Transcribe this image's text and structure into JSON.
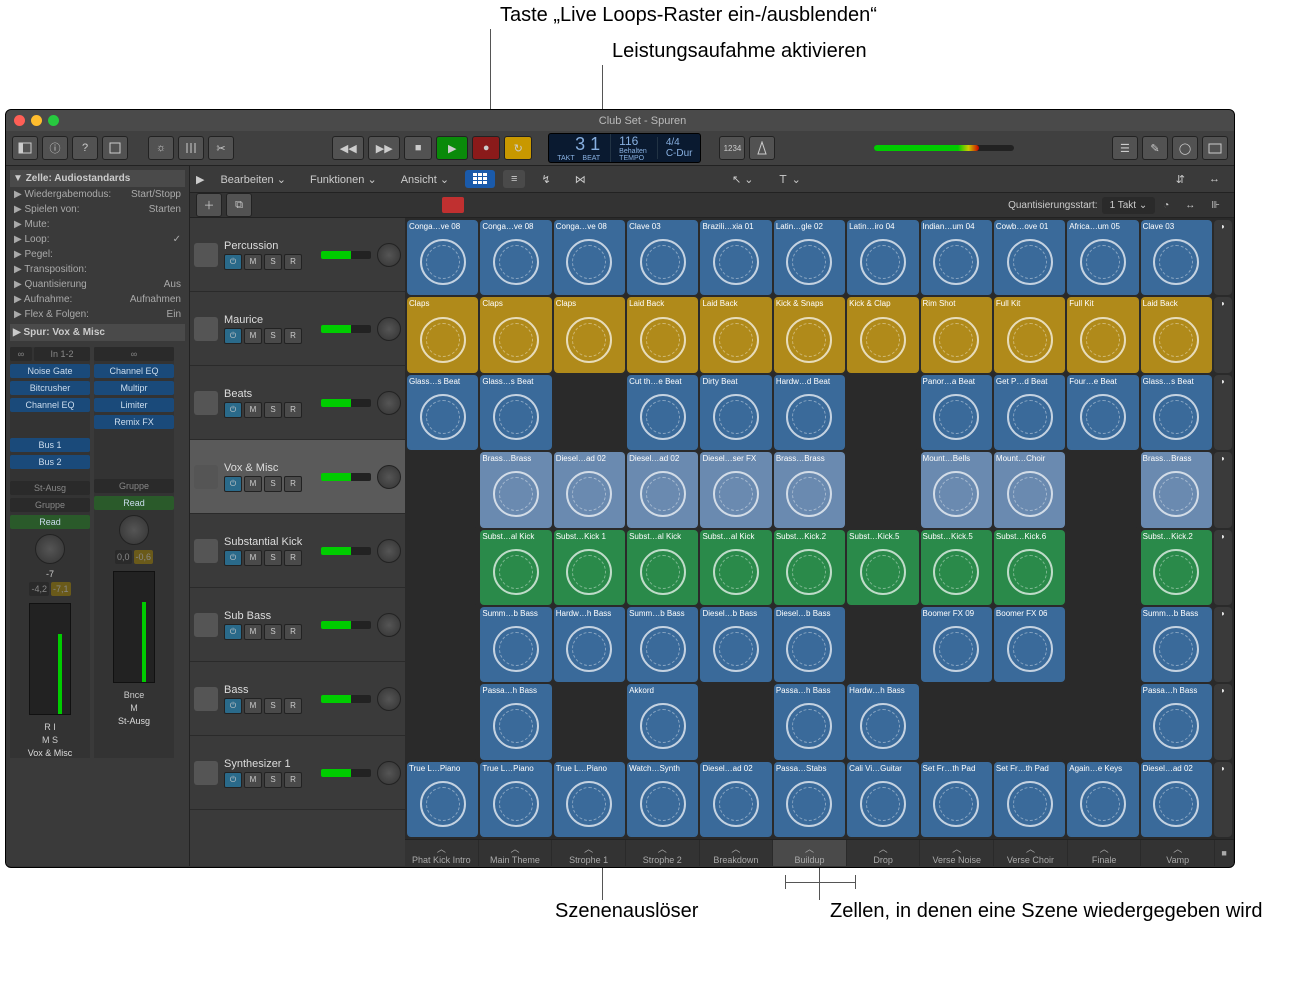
{
  "callouts": {
    "top1": "Taste „Live Loops-Raster ein-/ausblenden“",
    "top2": "Leistungsaufahme aktivieren",
    "bot1": "Szenenauslöser",
    "bot2": "Zellen, in denen eine Szene wiedergegeben wird"
  },
  "title": "Club Set - Spuren",
  "lcd": {
    "bars": "3",
    "beats": "1",
    "lbars": "TAKT",
    "lbeats": "BEAT",
    "tempo": "116",
    "tempo_l": "Behalten",
    "tempo_l2": "TEMPO",
    "sig": "4/4",
    "key": "C-Dur"
  },
  "secbar": {
    "edit": "Bearbeiten",
    "func": "Funktionen",
    "view": "Ansicht"
  },
  "qbar": {
    "qstart": "Quantisierungsstart:",
    "qval": "1 Takt"
  },
  "inspector": {
    "hdr": "Zelle: Audiostandards",
    "rows": [
      [
        "Wiedergabemodus:",
        "Start/Stopp"
      ],
      [
        "Spielen von:",
        "Starten"
      ],
      [
        "Mute:",
        ""
      ],
      [
        "Loop:",
        "✓"
      ],
      [
        "Pegel:",
        ""
      ],
      [
        "Transposition:",
        ""
      ],
      [
        "Quantisierung",
        "Aus"
      ],
      [
        "Aufnahme:",
        "Aufnahmen"
      ],
      [
        "Flex & Folgen:",
        "Ein"
      ]
    ],
    "spur": "Spur:  Vox & Misc"
  },
  "ch1": {
    "in": "In 1-2",
    "slots": [
      "Noise Gate",
      "Bitcrusher",
      "Channel EQ"
    ],
    "sends": [
      "Bus 1",
      "Bus 2"
    ],
    "out": "St-Ausg",
    "grp": "Gruppe",
    "auto": "Read",
    "db": "-7",
    "v1": "-4,2",
    "v2": "-7,1",
    "ri": "R  I",
    "ms": "M   S",
    "name": "Vox & Misc"
  },
  "ch2": {
    "slots": [
      "Channel EQ",
      "Multipr",
      "Limiter",
      "Remix FX"
    ],
    "out": "",
    "grp": "Gruppe",
    "auto": "Read",
    "db": "0,0",
    "v2": "-0,6",
    "bnce": "Bnce",
    "m": "M",
    "name": "St-Ausg"
  },
  "tracks": [
    "Percussion",
    "Maurice",
    "Beats",
    "Vox & Misc",
    "Substantial Kick",
    "Sub Bass",
    "Bass",
    "Synthesizer 1"
  ],
  "scenes": [
    "Phat Kick Intro",
    "Main Theme",
    "Strophe 1",
    "Strophe 2",
    "Breakdown",
    "Buildup",
    "Drop",
    "Verse Noise",
    "Verse Choir",
    "Finale",
    "Vamp"
  ],
  "cells": [
    [
      [
        "Conga…ve 08",
        "blue"
      ],
      [
        "Conga…ve 08",
        "blue"
      ],
      [
        "Conga…ve 08",
        "blue"
      ],
      [
        "Clave 03",
        "blue"
      ],
      [
        "Brazili…xia 01",
        "blue"
      ],
      [
        "Latin…gle 02",
        "blue"
      ],
      [
        "Latin…iro 04",
        "blue"
      ],
      [
        "Indian…um 04",
        "blue"
      ],
      [
        "Cowb…ove 01",
        "blue"
      ],
      [
        "Africa…um 05",
        "blue"
      ],
      [
        "Clave 03",
        "blue"
      ]
    ],
    [
      [
        "Claps",
        "yel"
      ],
      [
        "Claps",
        "yel"
      ],
      [
        "Claps",
        "yel"
      ],
      [
        "Laid Back",
        "yel"
      ],
      [
        "Laid Back",
        "yel"
      ],
      [
        "Kick & Snaps",
        "yel"
      ],
      [
        "Kick & Clap",
        "yel"
      ],
      [
        "Rim Shot",
        "yel"
      ],
      [
        "Full Kit",
        "yel"
      ],
      [
        "Full Kit",
        "yel"
      ],
      [
        "Laid Back",
        "yel"
      ]
    ],
    [
      [
        "Glass…s Beat",
        "blue"
      ],
      [
        "Glass…s Beat",
        "blue"
      ],
      [
        "",
        "empty"
      ],
      [
        "Cut th…e Beat",
        "blue"
      ],
      [
        "Dirty Beat",
        "blue"
      ],
      [
        "Hardw…d Beat",
        "blue"
      ],
      [
        "",
        "empty"
      ],
      [
        "Panor…a Beat",
        "blue"
      ],
      [
        "Get P…d Beat",
        "blue"
      ],
      [
        "Four…e Beat",
        "blue"
      ],
      [
        "Glass…s Beat",
        "blue"
      ]
    ],
    [
      [
        "",
        "empty"
      ],
      [
        "Brass…Brass",
        "ltblue"
      ],
      [
        "Diesel…ad 02",
        "ltblue"
      ],
      [
        "Diesel…ad 02",
        "ltblue"
      ],
      [
        "Diesel…ser FX",
        "ltblue"
      ],
      [
        "Brass…Brass",
        "ltblue"
      ],
      [
        "",
        "empty"
      ],
      [
        "Mount…Bells",
        "ltblue"
      ],
      [
        "Mount…Choir",
        "ltblue"
      ],
      [
        "",
        "empty"
      ],
      [
        "Brass…Brass",
        "ltblue"
      ]
    ],
    [
      [
        "",
        "empty"
      ],
      [
        "Subst…al Kick",
        "grn"
      ],
      [
        "Subst…Kick 1",
        "grn"
      ],
      [
        "Subst…al Kick",
        "grn"
      ],
      [
        "Subst…al Kick",
        "grn"
      ],
      [
        "Subst…Kick.2",
        "grn"
      ],
      [
        "Subst…Kick.5",
        "grn"
      ],
      [
        "Subst…Kick.5",
        "grn"
      ],
      [
        "Subst…Kick.6",
        "grn"
      ],
      [
        "",
        "empty"
      ],
      [
        "Subst…Kick.2",
        "grn"
      ]
    ],
    [
      [
        "",
        "empty"
      ],
      [
        "Summ…b Bass",
        "blue"
      ],
      [
        "Hardw…h Bass",
        "blue"
      ],
      [
        "Summ…b Bass",
        "blue"
      ],
      [
        "Diesel…b Bass",
        "blue"
      ],
      [
        "Diesel…b Bass",
        "blue"
      ],
      [
        "",
        "empty"
      ],
      [
        "Boomer FX 09",
        "blue"
      ],
      [
        "Boomer FX 06",
        "blue"
      ],
      [
        "",
        "empty"
      ],
      [
        "Summ…b Bass",
        "blue"
      ]
    ],
    [
      [
        "",
        "empty"
      ],
      [
        "Passa…h Bass",
        "blue"
      ],
      [
        "",
        "empty"
      ],
      [
        "Akkord",
        "blue"
      ],
      [
        "",
        "empty"
      ],
      [
        "Passa…h Bass",
        "blue"
      ],
      [
        "Hardw…h Bass",
        "blue"
      ],
      [
        "",
        "empty"
      ],
      [
        "",
        "empty"
      ],
      [
        "",
        "empty"
      ],
      [
        "Passa…h Bass",
        "blue"
      ]
    ],
    [
      [
        "True L…Piano",
        "blue"
      ],
      [
        "True L…Piano",
        "blue"
      ],
      [
        "True L…Piano",
        "blue"
      ],
      [
        "Watch…Synth",
        "blue"
      ],
      [
        "Diesel…ad 02",
        "blue"
      ],
      [
        "Passa…Stabs",
        "blue"
      ],
      [
        "Cali Vi…Guitar",
        "blue"
      ],
      [
        "Set Fr…th Pad",
        "blue"
      ],
      [
        "Set Fr…th Pad",
        "blue"
      ],
      [
        "Again…e Keys",
        "blue"
      ],
      [
        "Diesel…ad 02",
        "blue"
      ]
    ]
  ]
}
